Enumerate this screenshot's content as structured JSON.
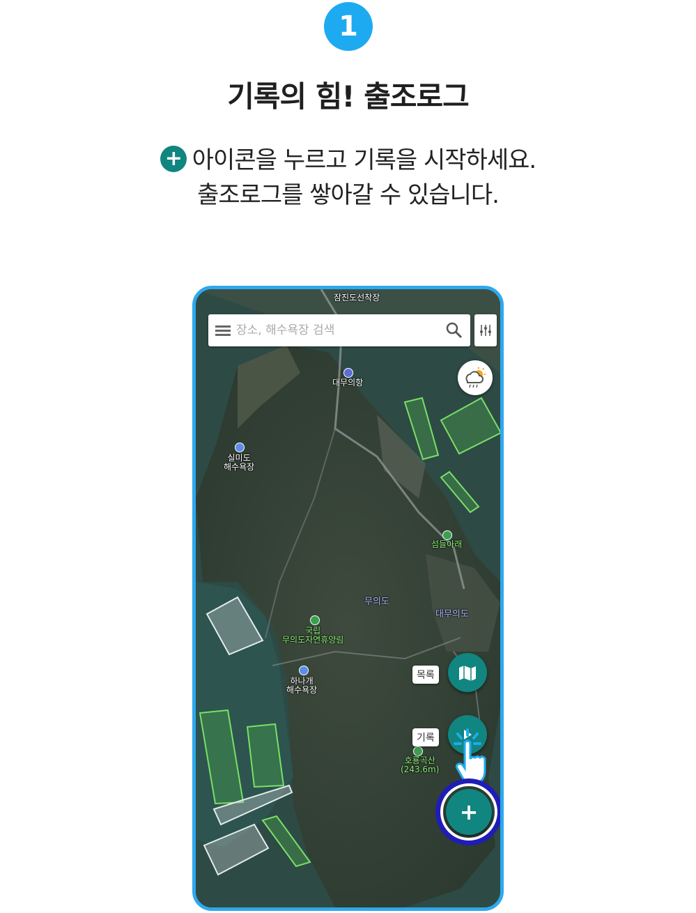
{
  "step": {
    "number": "1"
  },
  "headline": "기록의 힘! 출조로그",
  "description": {
    "icon": "plus-circle-icon",
    "line1": "아이콘을 누르고 기록을 시작하세요.",
    "line2": "출조로그를 쌓아갈 수 있습니다."
  },
  "app": {
    "search": {
      "placeholder": "장소, 해수욕장 검색",
      "value": ""
    },
    "map_labels": {
      "top_pier": "잠진도선착장",
      "port": "대무의항",
      "beach1": "실미도\n해수욕장",
      "trail": "섬들아래",
      "island": "무의도",
      "island2": "대무의도",
      "forest": "국립\n무의도자연휴양림",
      "beach2": "하나개\n해수욕장",
      "mountain": "호룡곡산\n(243.6m)"
    },
    "buttons": {
      "list_label": "목록",
      "record_label": "기록",
      "add": "+"
    }
  },
  "colors": {
    "accent_blue": "#1eaaf1",
    "teal": "#11857f",
    "ring": "#1f1cb8"
  }
}
